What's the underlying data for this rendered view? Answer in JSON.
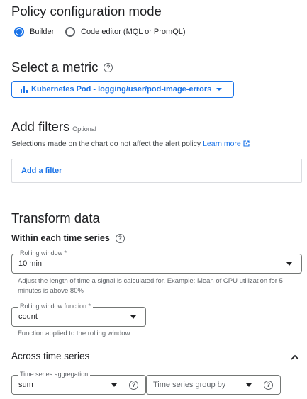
{
  "policy_mode": {
    "title": "Policy configuration mode",
    "options": [
      {
        "label": "Builder",
        "selected": true
      },
      {
        "label": "Code editor (MQL or PromQL)",
        "selected": false
      }
    ]
  },
  "metric": {
    "title": "Select a metric",
    "button_label": "Kubernetes Pod - logging/user/pod-image-errors"
  },
  "filters": {
    "title": "Add filters",
    "optional": "Optional",
    "description": "Selections made on the chart do not affect the alert policy",
    "learn_more": "Learn more",
    "add_filter": "Add a filter"
  },
  "transform": {
    "title": "Transform data",
    "within_title": "Within each time series",
    "rolling_window": {
      "label": "Rolling window *",
      "value": "10 min",
      "hint": "Adjust the length of time a signal is calculated for. Example: Mean of CPU utilization for 5 minutes is above 80%"
    },
    "rolling_function": {
      "label": "Rolling window function *",
      "value": "count",
      "hint": "Function applied to the rolling window"
    },
    "across_title": "Across time series",
    "aggregation": {
      "label": "Time series aggregation",
      "value": "sum"
    },
    "group_by": {
      "placeholder": "Time series group by"
    }
  },
  "colors": {
    "accent": "#1a73e8",
    "text": "#202124",
    "secondary": "#5f6368"
  }
}
